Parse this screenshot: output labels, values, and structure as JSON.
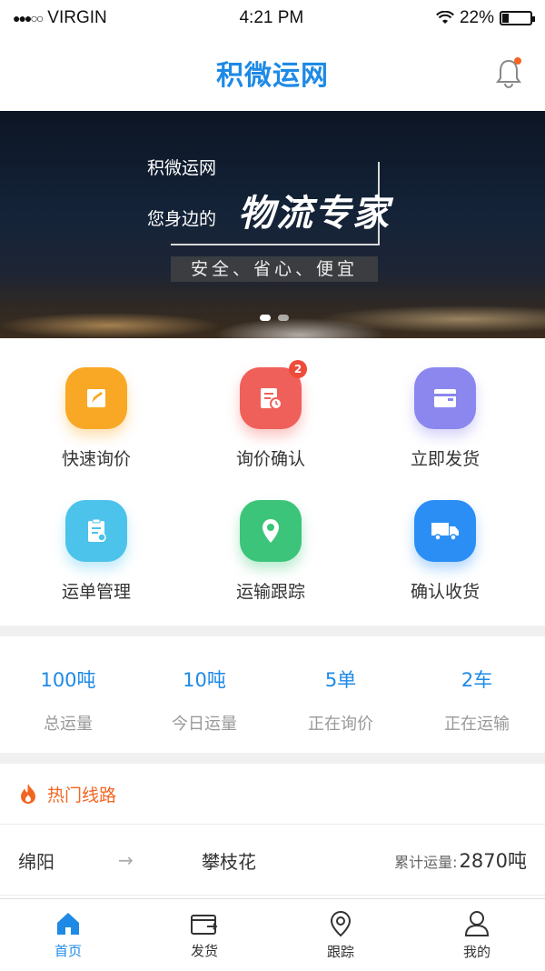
{
  "status_bar": {
    "signal": "●●●○○",
    "carrier": "VIRGIN",
    "time": "4:21 PM",
    "battery": "22%",
    "battery_level": 0.22
  },
  "header": {
    "title": "积微运网"
  },
  "banner": {
    "brand": "积微运网",
    "tagline": "您身边的",
    "slogan": "物流专家",
    "features": "安全、省心、便宜",
    "active_slide": 0,
    "slide_count": 2
  },
  "grid": [
    {
      "label": "快速询价",
      "icon": "edit-icon",
      "color": "#f9a825"
    },
    {
      "label": "询价确认",
      "icon": "quote-confirm-icon",
      "color": "#f0605a",
      "badge": "2"
    },
    {
      "label": "立即发货",
      "icon": "wallet-icon",
      "color": "#8b87ee"
    },
    {
      "label": "运单管理",
      "icon": "clipboard-icon",
      "color": "#4cc3ea"
    },
    {
      "label": "运输跟踪",
      "icon": "location-pin-icon",
      "color": "#3cc57a"
    },
    {
      "label": "确认收货",
      "icon": "truck-icon",
      "color": "#2b8ef5"
    }
  ],
  "stats": [
    {
      "value": "100吨",
      "label": "总运量"
    },
    {
      "value": "10吨",
      "label": "今日运量"
    },
    {
      "value": "5单",
      "label": "正在询价"
    },
    {
      "value": "2车",
      "label": "正在运输"
    }
  ],
  "hot_routes": {
    "title": "热门线路",
    "routes": [
      {
        "from": "绵阳",
        "arrow": "→",
        "to": "攀枝花",
        "total_label": "累计运量:",
        "total_value": "2870吨"
      }
    ]
  },
  "tabbar": [
    {
      "label": "首页",
      "icon": "home-icon",
      "active": true
    },
    {
      "label": "发货",
      "icon": "ship-icon",
      "active": false
    },
    {
      "label": "跟踪",
      "icon": "location-icon",
      "active": false
    },
    {
      "label": "我的",
      "icon": "user-icon",
      "active": false
    }
  ],
  "colors": {
    "accent": "#1e8ae6",
    "hot": "#f26522"
  }
}
